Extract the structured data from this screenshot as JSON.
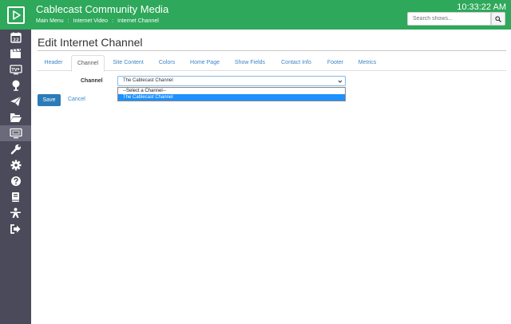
{
  "header": {
    "title": "Cablecast Community Media",
    "breadcrumbs": [
      "Main Menu",
      "Internet Video",
      "Internet Channel"
    ],
    "separator": ":",
    "clock": "10:33:22 AM",
    "search_placeholder": "Search shows..."
  },
  "sidebar": {
    "items": [
      {
        "icon": "calendar-icon",
        "label": "22"
      },
      {
        "icon": "clapperboard-icon"
      },
      {
        "icon": "tv-channel-icon",
        "label": "TV"
      },
      {
        "icon": "podcast-icon"
      },
      {
        "icon": "paper-plane-icon"
      },
      {
        "icon": "folder-open-icon"
      },
      {
        "icon": "monitor-icon",
        "active": true
      },
      {
        "icon": "wrench-icon"
      },
      {
        "icon": "gear-icon"
      },
      {
        "icon": "question-icon"
      },
      {
        "icon": "book-icon"
      },
      {
        "icon": "person-icon"
      },
      {
        "icon": "sign-out-icon"
      }
    ]
  },
  "page": {
    "title": "Edit Internet Channel",
    "tabs": [
      "Header",
      "Channel",
      "Site Content",
      "Colors",
      "Home Page",
      "Show Fields",
      "Contact Info",
      "Footer",
      "Metrics"
    ],
    "active_tab": "Channel"
  },
  "form": {
    "channel_label": "Channel",
    "channel_selected": "The Cablecast Channel",
    "options": [
      "--Select a Channel--",
      "The Cablecast Channel"
    ],
    "highlighted_option": "The Cablecast Channel",
    "save_label": "Save",
    "cancel_label": "Cancel"
  },
  "colors": {
    "brand_green": "#2ea85a",
    "sidebar_bg": "#4a4a5a",
    "link_blue": "#3a87c8",
    "primary_button": "#2b7bb9",
    "option_highlight": "#1e90ff"
  }
}
